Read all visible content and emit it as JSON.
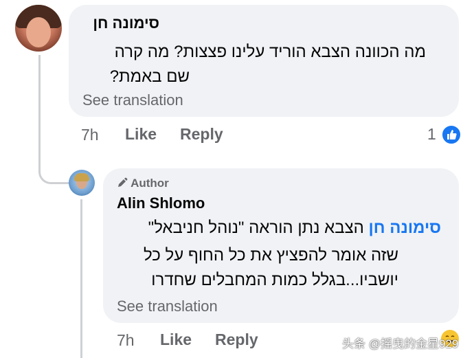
{
  "comment": {
    "author": "סימונה חן",
    "text_line1": "מה הכוונה הצבא הוריד עלינו פצצות? מה קרה",
    "text_line2": "שם באמת?",
    "see_translation": "See translation",
    "time": "7h",
    "like_label": "Like",
    "reply_label": "Reply",
    "reaction_count": "1",
    "reaction_icon": "thumbs-up-icon"
  },
  "reply": {
    "badge_label": "Author",
    "badge_icon": "pencil-icon",
    "author": "Alin Shlomo",
    "mention": "סימונה חן",
    "text_line1_rest": " הצבא נתן הוראה \"נוהל חניבאל\"",
    "text_line2": "שזה אומר להפציץ את כל החוף על כל",
    "text_line3": "יושביו...בגלל כמות המחבלים שחדרו",
    "see_translation": "See translation",
    "time": "7h",
    "like_label": "Like",
    "reply_label": "Reply"
  },
  "watermark": "头条 @摇曳的金星929",
  "colors": {
    "bubble": "#f0f2f5",
    "secondary_text": "#65676b",
    "mention": "#1877f2",
    "like_blue": "#1877f2"
  }
}
